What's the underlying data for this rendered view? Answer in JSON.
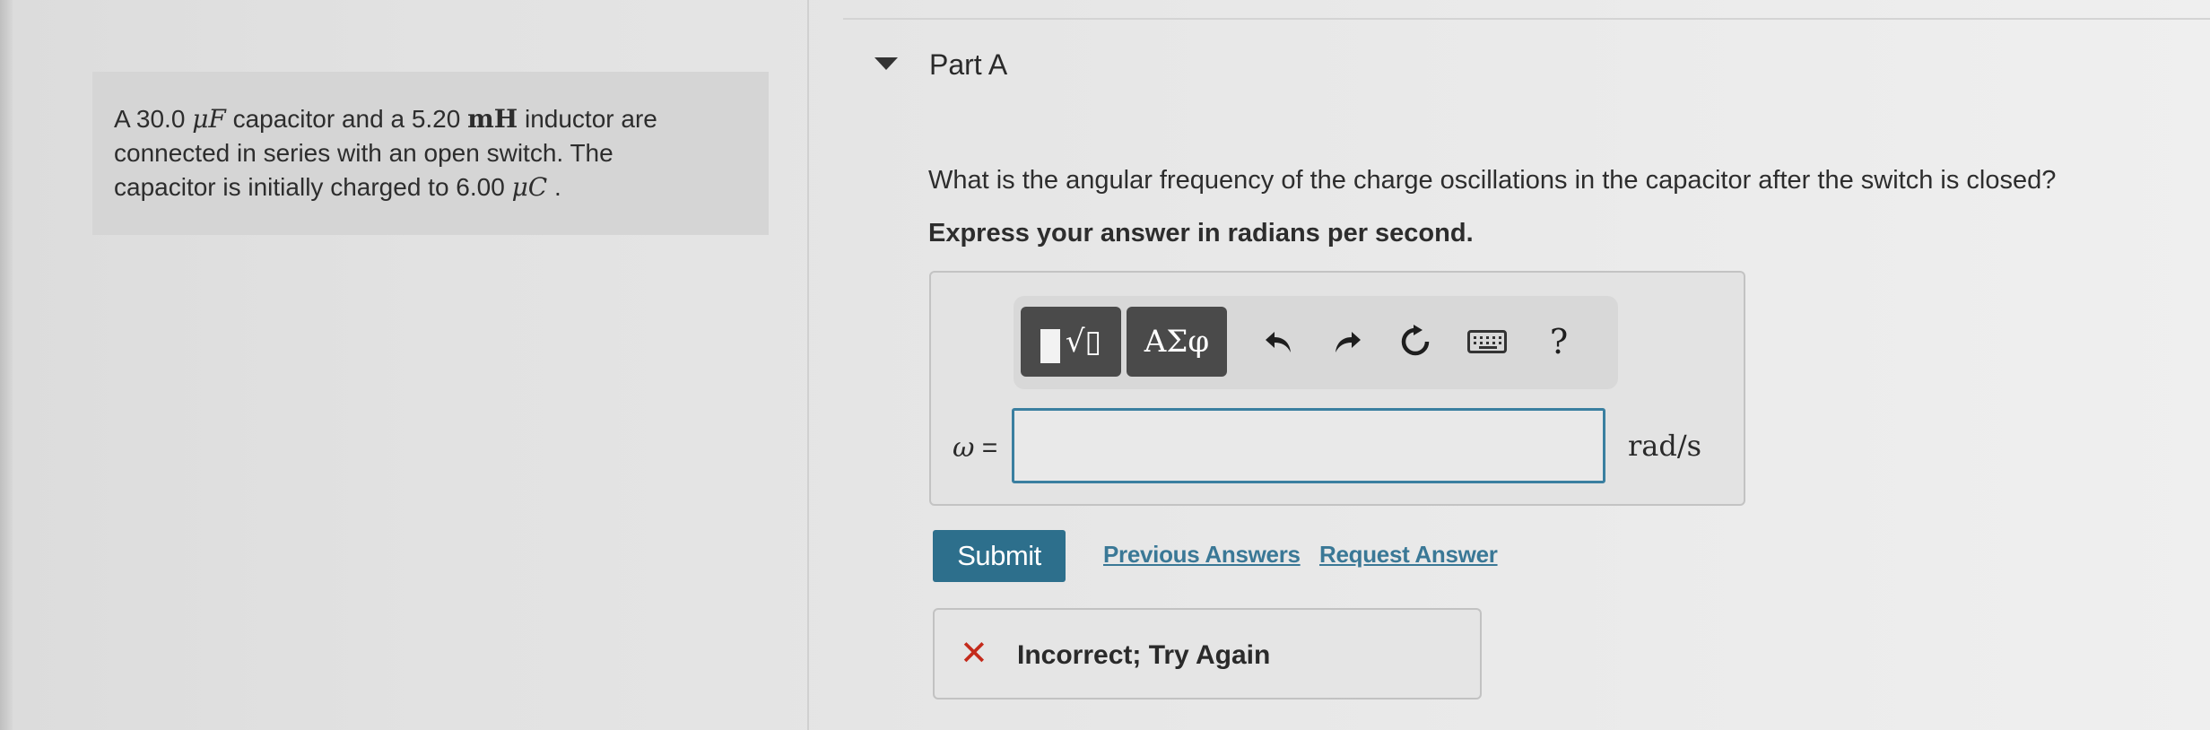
{
  "problem": {
    "line1_pre": "A 30.0 ",
    "line1_unit": "μF",
    "line1_mid": " capacitor and a 5.20 ",
    "line1_unit2": "mH",
    "line1_post": " inductor are",
    "line2": "connected in series with an open switch. The",
    "line3_pre": "capacitor is initially charged to 6.00 ",
    "line3_unit": "μC",
    "line3_post": " ."
  },
  "part": {
    "title": "Part A",
    "question": "What is the angular frequency of the charge oscillations in the capacitor after the switch is closed?",
    "instruction": "Express your answer in radians per second."
  },
  "toolbar": {
    "templates_glyph": "√▯",
    "greek_label": "ΑΣφ",
    "undo_icon": "undo-icon",
    "redo_icon": "redo-icon",
    "reset_icon": "reset-icon",
    "keyboard_icon": "keyboard-icon",
    "help_label": "?"
  },
  "answer": {
    "variable": "ω",
    "equals": " =",
    "value": "",
    "unit": "rad/s"
  },
  "actions": {
    "submit_label": "Submit",
    "previous_answers_label": "Previous Answers",
    "request_answer_label": "Request Answer"
  },
  "feedback": {
    "icon": "x-mark-icon",
    "text": "Incorrect; Try Again",
    "icon_color": "#c42b1c"
  },
  "colors": {
    "accent": "#2d6f8c",
    "link": "#3a7896",
    "input_border": "#3a7fa0"
  }
}
